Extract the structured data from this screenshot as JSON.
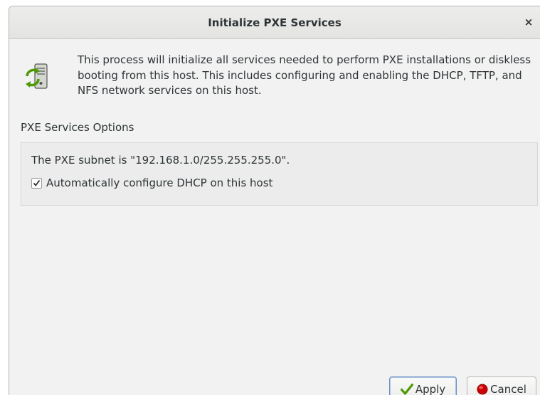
{
  "window": {
    "title": "Initialize PXE Services",
    "close_glyph": "×"
  },
  "info": {
    "icon": "network-server-refresh-icon",
    "text": "This process will initialize all services needed to perform PXE installations or diskless booting from this host.  This includes configuring and enabling the DHCP, TFTP, and NFS network services on this host."
  },
  "options": {
    "section_label": "PXE Services Options",
    "subnet_text": "The PXE subnet is \"192.168.1.0/255.255.255.0\".",
    "dhcp_checkbox": {
      "label": "Automatically configure DHCP on this host",
      "checked": true
    }
  },
  "buttons": {
    "apply_label": "Apply",
    "apply_icon": "checkmark-icon",
    "cancel_label": "Cancel",
    "cancel_icon": "red-circle-icon"
  },
  "colors": {
    "window_bg": "#f2f2f2",
    "frame_bg": "#ececec",
    "text": "#2e3436",
    "apply_check": "#4e9a06",
    "cancel_dot": "#cc0000"
  }
}
